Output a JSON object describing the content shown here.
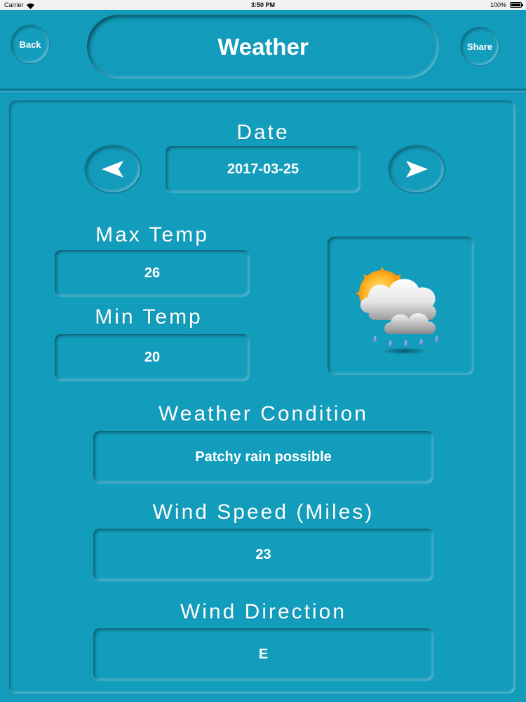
{
  "status_bar": {
    "carrier": "Carrier",
    "time": "3:50 PM",
    "battery": "100%"
  },
  "header": {
    "back_label": "Back",
    "title": "Weather",
    "share_label": "Share"
  },
  "date": {
    "label": "Date",
    "value": "2017-03-25"
  },
  "max_temp": {
    "label": "Max Temp",
    "value": "26"
  },
  "min_temp": {
    "label": "Min Temp",
    "value": "20"
  },
  "condition": {
    "label": "Weather Condition",
    "value": "Patchy rain possible",
    "icon": "sun-cloud-rain-icon"
  },
  "wind_speed": {
    "label": "Wind Speed (Miles)",
    "value": "23"
  },
  "wind_direction": {
    "label": "Wind Direction",
    "value": "E"
  },
  "colors": {
    "background": "#129bba",
    "status_bar": "#f2f2f2",
    "text": "#ffffff"
  }
}
